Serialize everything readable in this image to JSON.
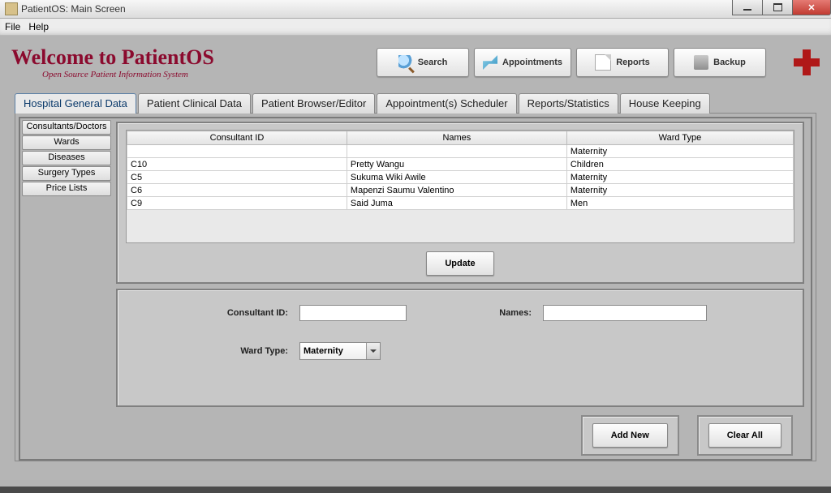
{
  "window": {
    "title": "PatientOS: Main Screen"
  },
  "menubar": {
    "file": "File",
    "help": "Help"
  },
  "header": {
    "title": "Welcome to PatientOS",
    "subtitle": "Open Source Patient Information System"
  },
  "toolbar": {
    "search": "Search",
    "appointments": "Appointments",
    "reports": "Reports",
    "backup": "Backup"
  },
  "tabs": [
    "Hospital General Data",
    "Patient Clinical Data",
    "Patient Browser/Editor",
    "Appointment(s) Scheduler",
    "Reports/Statistics",
    "House Keeping"
  ],
  "sidebar": [
    "Consultants/Doctors",
    "Wards",
    "Diseases",
    "Surgery Types",
    "Price Lists"
  ],
  "table": {
    "headers": [
      "Consultant ID",
      "Names",
      "Ward Type"
    ],
    "rows": [
      {
        "id": "",
        "names": "",
        "ward": "Maternity"
      },
      {
        "id": "C10",
        "names": "Pretty Wangu",
        "ward": "Children"
      },
      {
        "id": "C5",
        "names": "Sukuma Wiki Awile",
        "ward": "Maternity"
      },
      {
        "id": "C6",
        "names": "Mapenzi Saumu  Valentino",
        "ward": "Maternity"
      },
      {
        "id": "C9",
        "names": "Said Juma",
        "ward": "Men"
      }
    ]
  },
  "buttons": {
    "update": "Update",
    "addnew": "Add New",
    "clear": "Clear All"
  },
  "form": {
    "consultant_id_label": "Consultant ID:",
    "names_label": "Names:",
    "ward_type_label": "Ward Type:",
    "ward_type_value": "Maternity"
  }
}
